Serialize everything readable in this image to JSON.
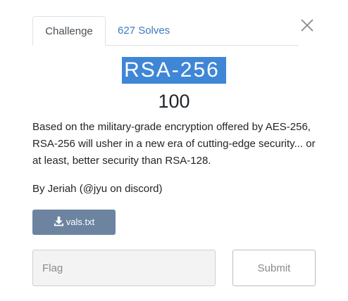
{
  "tabs": {
    "challenge_label": "Challenge",
    "solves_label": "627 Solves"
  },
  "challenge": {
    "name": "RSA-256",
    "points": "100",
    "description": "Based on the military-grade encryption offered by AES-256, RSA-256 will usher in a new era of cutting-edge security... or at least, better security than RSA-128.",
    "author": "By Jeriah (@jyu on discord)"
  },
  "files": [
    {
      "label": "vals.txt",
      "icon": "download-icon"
    }
  ],
  "form": {
    "flag_placeholder": "Flag",
    "flag_value": "",
    "submit_label": "Submit"
  },
  "icons": {
    "close": "close-icon"
  },
  "colors": {
    "title_highlight": "#3f86d6",
    "link": "#3b7bbf",
    "file_button": "#6c84a0"
  }
}
